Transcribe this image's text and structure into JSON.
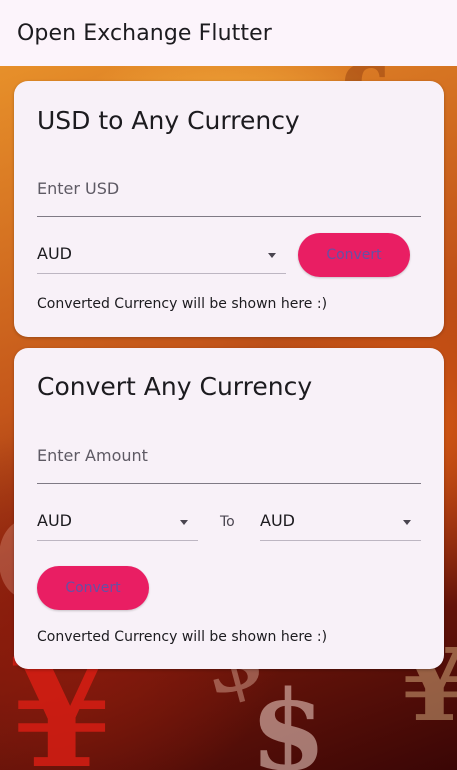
{
  "appbar": {
    "title": "Open Exchange Flutter"
  },
  "card_usd": {
    "title": "USD to Any Currency",
    "input_placeholder": "Enter USD",
    "currency": "AUD",
    "convert_label": "Convert",
    "result_text": "Converted Currency will be shown here :)"
  },
  "card_any": {
    "title": "Convert Any Currency",
    "input_placeholder": "Enter Amount",
    "from_currency": "AUD",
    "to_label": "To",
    "to_currency": "AUD",
    "convert_label": "Convert",
    "result_text": "Converted Currency will be shown here :)"
  },
  "colors": {
    "accent": "#e91e63",
    "button_text": "#6750a4",
    "card_bg": "#f8f1f8"
  }
}
